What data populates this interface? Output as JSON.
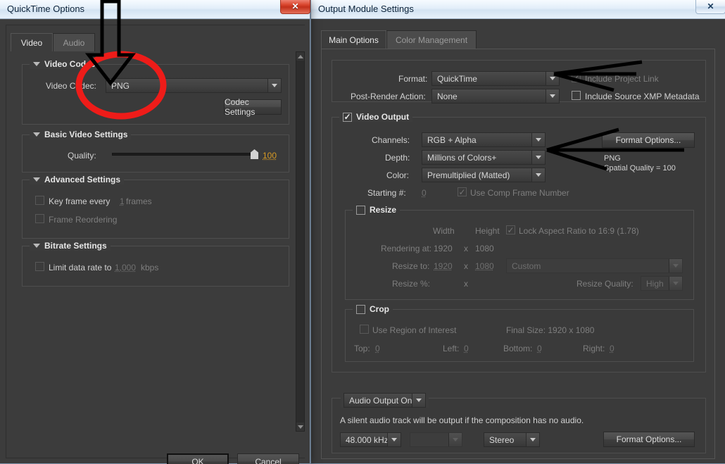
{
  "quicktime_window": {
    "title": "QuickTime Options",
    "close_label": "✕",
    "tabs": [
      {
        "label": "Video",
        "active": true
      },
      {
        "label": "Audio",
        "active": false
      }
    ],
    "video_codec_group": {
      "title": "Video Codec",
      "codec_label": "Video Codec:",
      "codec_value": "PNG",
      "codec_settings_button": "Codec Settings"
    },
    "basic_video_group": {
      "title": "Basic Video Settings",
      "quality_label": "Quality:",
      "quality_value": "100"
    },
    "advanced_group": {
      "title": "Advanced Settings",
      "key_frame_label": "Key frame every",
      "key_frame_value": "1",
      "key_frame_units": "frames",
      "frame_reordering_label": "Frame Reordering"
    },
    "bitrate_group": {
      "title": "Bitrate Settings",
      "limit_label": "Limit data rate to",
      "limit_value": "1,000",
      "limit_units": "kbps"
    },
    "footer": {
      "ok_label": "OK",
      "cancel_label": "Cancel"
    }
  },
  "output_module_window": {
    "title": "Output Module Settings",
    "close_label": "✕",
    "tabs": [
      {
        "label": "Main Options",
        "active": true
      },
      {
        "label": "Color Management",
        "active": false
      }
    ],
    "format_group": {
      "format_label": "Format:",
      "format_value": "QuickTime",
      "post_render_label": "Post-Render Action:",
      "post_render_value": "None",
      "include_project_link_label": "Include Project Link",
      "include_project_link_checked": true,
      "include_xmp_label": "Include Source XMP Metadata",
      "include_xmp_checked": false
    },
    "video_output_group": {
      "title": "Video Output",
      "checked": true,
      "channels_label": "Channels:",
      "channels_value": "RGB + Alpha",
      "depth_label": "Depth:",
      "depth_value": "Millions of Colors+",
      "color_label": "Color:",
      "color_value": "Premultiplied (Matted)",
      "starting_num_label": "Starting #:",
      "starting_num_value": "0",
      "use_comp_frame_label": "Use Comp Frame Number",
      "format_options_button": "Format Options...",
      "info_line1": "PNG",
      "info_line2": "Spatial Quality = 100"
    },
    "resize_group": {
      "title": "Resize",
      "checked": false,
      "width_header": "Width",
      "height_header": "Height",
      "lock_aspect_label": "Lock Aspect Ratio to 16:9 (1.78)",
      "lock_aspect_checked": true,
      "rendering_at_label": "Rendering at:",
      "rendering_width": "1920",
      "rendering_x": "x",
      "rendering_height": "1080",
      "resize_to_label": "Resize to:",
      "resize_width": "1920",
      "resize_x": "x",
      "resize_height": "1080",
      "resize_preset": "Custom",
      "resize_pct_label": "Resize %:",
      "resize_pct_x": "x",
      "resize_quality_label": "Resize Quality:",
      "resize_quality_value": "High"
    },
    "crop_group": {
      "title": "Crop",
      "checked": false,
      "use_roi_label": "Use Region of Interest",
      "final_size_label": "Final Size: 1920 x 1080",
      "top_label": "Top:",
      "top_value": "0",
      "left_label": "Left:",
      "left_value": "0",
      "bottom_label": "Bottom:",
      "bottom_value": "0",
      "right_label": "Right:",
      "right_value": "0"
    },
    "audio_group": {
      "toggle_value": "Audio Output On",
      "note": "A silent audio track will be output if the composition has no audio.",
      "sample_rate_value": "48.000 kHz",
      "bit_depth_value": "",
      "channels_value": "Stereo",
      "format_options_button": "Format Options..."
    }
  },
  "annotations": {
    "circle_color": "#ee1c19",
    "arrow_color": "#000000",
    "circle_target": "PNG codec dropdown",
    "arrow_down_target": "Video Codec PNG field",
    "arrow_format_target": "Format QuickTime dropdown",
    "arrow_channels_target": "Channels RGB + Alpha dropdown"
  }
}
